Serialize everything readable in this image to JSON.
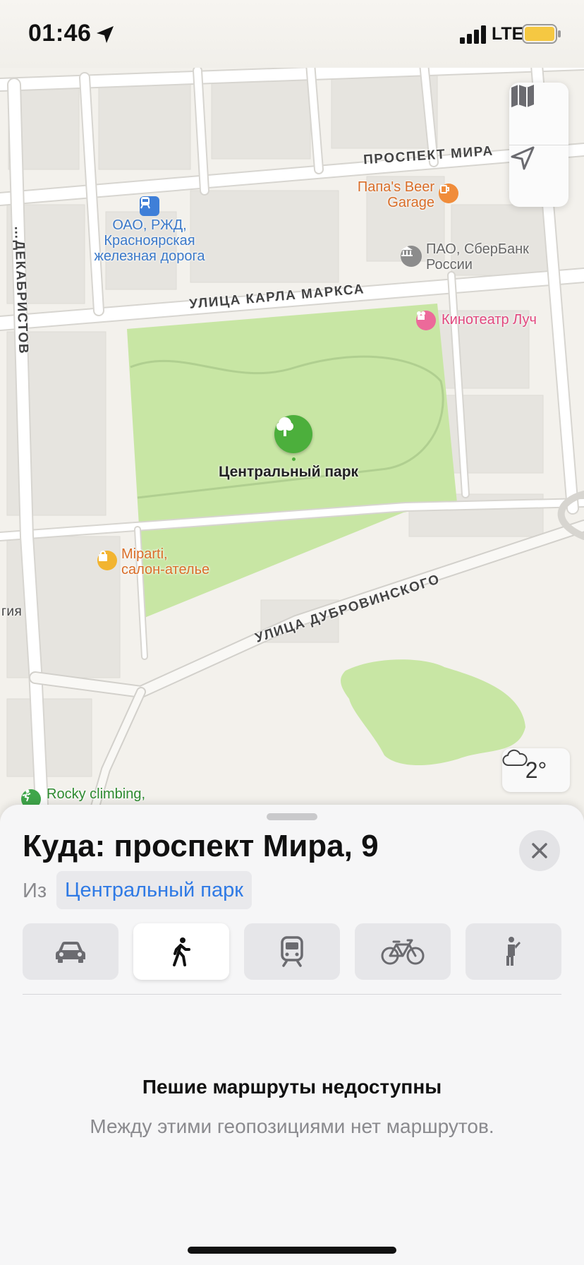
{
  "status_bar": {
    "time": "01:46",
    "network": "LTE",
    "battery_color": "#f5c842"
  },
  "map": {
    "streets": {
      "prospekt_mira": "ПРОСПЕКТ МИРА",
      "karla_marksa": "УЛИЦА КАРЛА МАРКСА",
      "dubrovinskogo": "УЛИЦА ДУБРОВИНСКОГО",
      "dekabristov": "…ДЕКАБРИСТОВ",
      "partial_left": "гия"
    },
    "pois": {
      "rzd": [
        "ОАО, РЖД,",
        "Красноярская",
        "железная дорога"
      ],
      "papas_beer": [
        "Папа's Beer",
        "Garage"
      ],
      "sberbank": [
        "ПАО, СберБанк",
        "России"
      ],
      "cinema": "Кинотеатр Луч",
      "park": "Центральный парк",
      "miparti": [
        "Miparti,",
        "салон-ателье"
      ],
      "rocky": "Rocky climbing,"
    },
    "colors": {
      "land": "#f3f1ec",
      "park": "#c8e6a4",
      "road": "#ffffff",
      "road_edge": "#d7d5d0",
      "building": "#e6e4df"
    },
    "weather": {
      "icon": "cloud-icon",
      "temperature": "2°"
    }
  },
  "sheet": {
    "title": "Куда: проспект Мира, 9",
    "from_label": "Из",
    "from_value": "Центральный парк",
    "modes": [
      {
        "name": "drive",
        "icon": "car-icon",
        "active": false
      },
      {
        "name": "walk",
        "icon": "walking-icon",
        "active": true
      },
      {
        "name": "transit",
        "icon": "train-icon",
        "active": false
      },
      {
        "name": "cycle",
        "icon": "bicycle-icon",
        "active": false
      },
      {
        "name": "ride",
        "icon": "rideshare-icon",
        "active": false
      }
    ],
    "message_title": "Пешие маршруты недоступны",
    "message_subtitle": "Между этими геопозициями нет маршрутов."
  }
}
